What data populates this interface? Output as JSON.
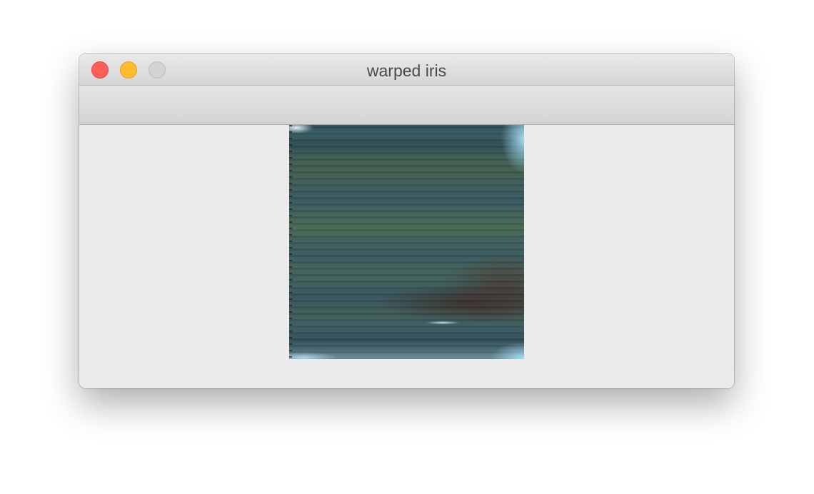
{
  "window": {
    "title": "warped iris"
  },
  "traffic_lights": {
    "close_color": "#fe5f57",
    "minimize_color": "#febc2e",
    "zoom_color": "#d3d3d3"
  },
  "image": {
    "icon": "warped-iris-image"
  }
}
